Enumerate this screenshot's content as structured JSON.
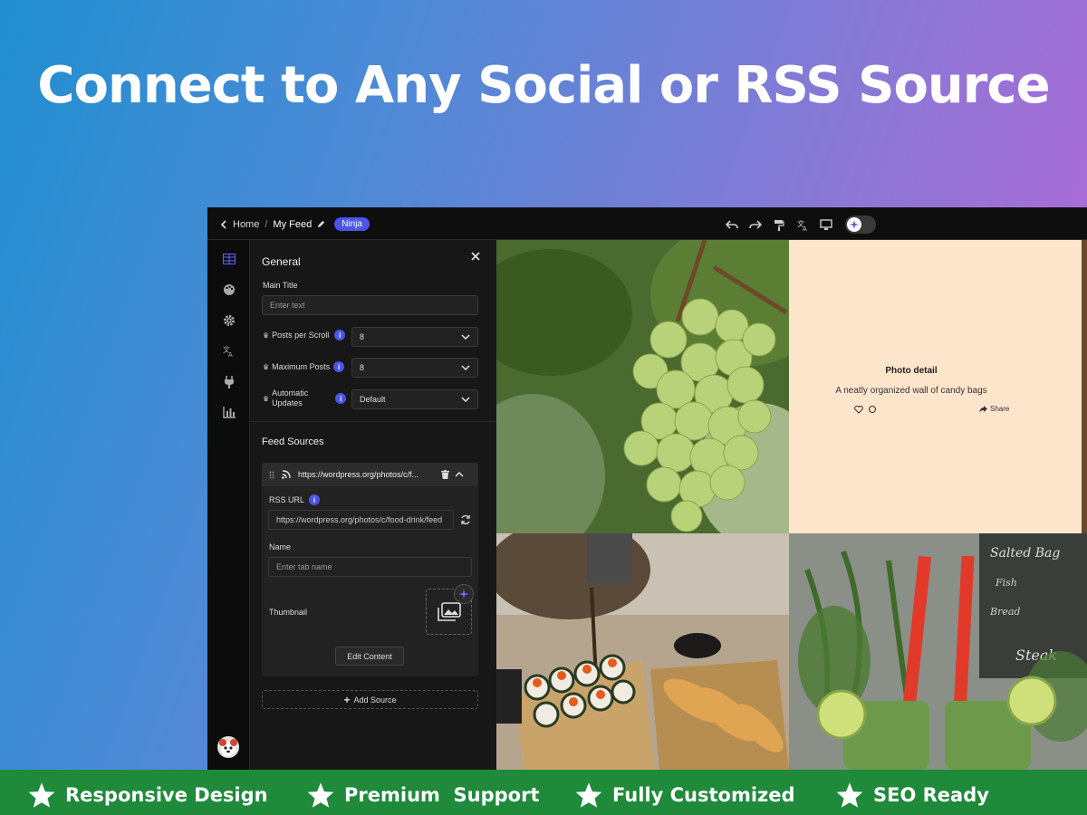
{
  "headline": "Connect to Any Social or RSS Source",
  "topbar": {
    "home": "Home",
    "sep": "/",
    "feed_name": "My Feed",
    "badge": "Ninja"
  },
  "panel": {
    "title": "General",
    "main_title_label": "Main Title",
    "main_title_placeholder": "Enter text",
    "posts_per_scroll_label": "Posts per Scroll",
    "posts_per_scroll_value": "8",
    "max_posts_label": "Maximum Posts",
    "max_posts_value": "8",
    "auto_updates_label_1": "Automatic",
    "auto_updates_label_2": "Updates",
    "auto_updates_value": "Default",
    "feed_sources_title": "Feed Sources",
    "source": {
      "url_short": "https://wordpress.org/photos/c/f...",
      "rss_label": "RSS URL",
      "rss_value": "https://wordpress.org/photos/c/food-drink/feed",
      "name_label": "Name",
      "name_placeholder": "Enter tab name",
      "thumbnail_label": "Thumbnail",
      "edit_button": "Edit Content"
    },
    "add_source": "Add Source"
  },
  "detail": {
    "title": "Photo detail",
    "description": "A neatly organized wall of candy bags",
    "share": "Share"
  },
  "features": [
    "Responsive Design",
    "Premium  Support",
    "Fully Customized",
    "SEO Ready"
  ],
  "colors": {
    "accent": "#4b55e8",
    "ribbon": "#1f8a3a",
    "detail_bg": "#fde5cc"
  },
  "icons": [
    "chevron-left-icon",
    "pencil-icon",
    "undo-icon",
    "redo-icon",
    "paint-roller-icon",
    "translate-icon",
    "monitor-icon",
    "sparkle-icon",
    "table-icon",
    "palette-icon",
    "gear-icon",
    "plug-icon",
    "bar-chart-icon",
    "close-icon",
    "crown-icon",
    "info-icon",
    "chevron-down-icon",
    "drag-handle-icon",
    "rss-icon",
    "trash-icon",
    "chevron-up-icon",
    "refresh-icon",
    "image-stack-icon",
    "plus-icon",
    "heart-icon",
    "comment-icon",
    "share-icon",
    "star-icon"
  ]
}
